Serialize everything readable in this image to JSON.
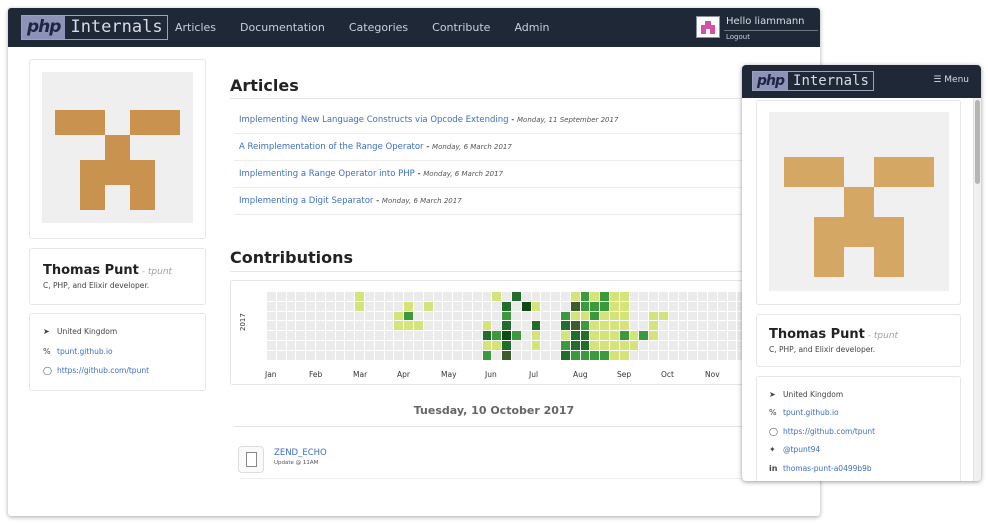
{
  "brand": {
    "php": "php",
    "internals": "Internals"
  },
  "nav": {
    "items": [
      "Articles",
      "Documentation",
      "Categories",
      "Contribute",
      "Admin"
    ],
    "user_greeting": "Hello liammann",
    "logout": "Logout"
  },
  "profile": {
    "name": "Thomas Punt",
    "nick_sep": " - ",
    "nick": "tpunt",
    "bio": "C, PHP, and Elixir developer.",
    "location": "United Kingdom",
    "website": "tpunt.github.io",
    "github": "https://github.com/tpunt",
    "twitter": "@tpunt94",
    "linkedin": "thomas-punt-a0499b9b",
    "identicon_color": "#c9924f",
    "identicon_color_mobile": "#d4a764"
  },
  "articles": {
    "title": "Articles",
    "items": [
      {
        "title": "Implementing New Language Constructs via Opcode Extending",
        "date": "Monday, 11 September 2017"
      },
      {
        "title": "A Reimplementation of the Range Operator",
        "date": "Monday, 6 March 2017"
      },
      {
        "title": "Implementing a Range Operator into PHP",
        "date": "Monday, 6 March 2017"
      },
      {
        "title": "Implementing a Digit Separator",
        "date": "Monday, 6 March 2017"
      }
    ]
  },
  "contributions": {
    "title": "Contributions",
    "year": "2017",
    "months": [
      "Jan",
      "Feb",
      "Mar",
      "Apr",
      "May",
      "Jun",
      "Jul",
      "Aug",
      "Sep",
      "Oct",
      "Nov"
    ],
    "levels": {
      "0": "#ebebeb",
      "1": "#d4e37a",
      "2": "#3b9a3b",
      "3": "#216e2a",
      "4": "#0f4a16",
      "5": "#3f5a2c"
    },
    "visible_weeks": 50,
    "cells": [
      [
        9,
        0,
        1
      ],
      [
        9,
        1,
        1
      ],
      [
        14,
        1,
        1
      ],
      [
        16,
        1,
        1
      ],
      [
        13,
        2,
        1
      ],
      [
        14,
        2,
        2
      ],
      [
        13,
        3,
        1
      ],
      [
        14,
        3,
        1
      ],
      [
        15,
        3,
        1
      ],
      [
        22,
        3,
        1
      ],
      [
        22,
        4,
        3
      ],
      [
        22,
        5,
        1
      ],
      [
        22,
        6,
        2
      ],
      [
        23,
        0,
        1
      ],
      [
        23,
        4,
        2
      ],
      [
        23,
        5,
        1
      ],
      [
        24,
        1,
        3
      ],
      [
        24,
        2,
        2
      ],
      [
        24,
        3,
        3
      ],
      [
        24,
        4,
        4
      ],
      [
        24,
        5,
        3
      ],
      [
        24,
        6,
        5
      ],
      [
        25,
        0,
        3
      ],
      [
        25,
        4,
        2
      ],
      [
        26,
        1,
        4
      ],
      [
        27,
        1,
        1
      ],
      [
        27,
        3,
        3
      ],
      [
        27,
        4,
        1
      ],
      [
        27,
        5,
        1
      ],
      [
        30,
        2,
        2
      ],
      [
        30,
        3,
        3
      ],
      [
        30,
        4,
        1
      ],
      [
        30,
        5,
        2
      ],
      [
        30,
        6,
        3
      ],
      [
        31,
        0,
        1
      ],
      [
        31,
        1,
        5
      ],
      [
        31,
        2,
        1
      ],
      [
        31,
        3,
        5
      ],
      [
        31,
        4,
        3
      ],
      [
        31,
        5,
        3
      ],
      [
        31,
        6,
        2
      ],
      [
        32,
        0,
        2
      ],
      [
        32,
        1,
        2
      ],
      [
        32,
        2,
        1
      ],
      [
        32,
        3,
        2
      ],
      [
        32,
        4,
        3
      ],
      [
        32,
        5,
        3
      ],
      [
        32,
        6,
        2
      ],
      [
        33,
        0,
        1
      ],
      [
        33,
        1,
        2
      ],
      [
        33,
        2,
        2
      ],
      [
        33,
        3,
        1
      ],
      [
        33,
        4,
        1
      ],
      [
        33,
        5,
        1
      ],
      [
        33,
        6,
        2
      ],
      [
        34,
        0,
        2
      ],
      [
        34,
        1,
        2
      ],
      [
        34,
        2,
        1
      ],
      [
        34,
        3,
        1
      ],
      [
        34,
        4,
        1
      ],
      [
        34,
        5,
        1
      ],
      [
        34,
        6,
        2
      ],
      [
        35,
        0,
        1
      ],
      [
        35,
        1,
        1
      ],
      [
        35,
        2,
        1
      ],
      [
        35,
        3,
        1
      ],
      [
        35,
        4,
        1
      ],
      [
        35,
        5,
        1
      ],
      [
        35,
        6,
        1
      ],
      [
        36,
        0,
        1
      ],
      [
        36,
        1,
        1
      ],
      [
        36,
        2,
        1
      ],
      [
        36,
        3,
        1
      ],
      [
        36,
        4,
        2
      ],
      [
        36,
        5,
        1
      ],
      [
        36,
        6,
        1
      ],
      [
        37,
        4,
        1
      ],
      [
        37,
        5,
        1
      ],
      [
        38,
        4,
        2
      ],
      [
        39,
        2,
        1
      ],
      [
        39,
        3,
        1
      ],
      [
        39,
        4,
        1
      ],
      [
        40,
        2,
        1
      ]
    ]
  },
  "activity": {
    "date": "Tuesday, 10 October 2017",
    "items": [
      {
        "title": "ZEND_ECHO",
        "subtitle": "Update @ 11AM"
      }
    ]
  },
  "mobile": {
    "menu_label": "Menu"
  }
}
